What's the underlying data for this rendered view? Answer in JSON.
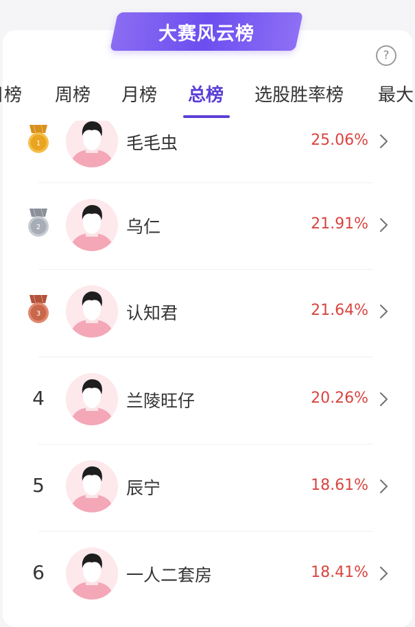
{
  "banner": {
    "title": "大赛风云榜"
  },
  "help": {
    "icon": "question-circle-icon",
    "label": "?"
  },
  "tabs": [
    {
      "label": "日榜"
    },
    {
      "label": "周榜"
    },
    {
      "label": "月榜"
    },
    {
      "label": "总榜",
      "active": true
    },
    {
      "label": "选股胜率榜"
    },
    {
      "label": "最大"
    }
  ],
  "leaderboard": [
    {
      "rank": "1",
      "badge": "gold-medal-icon",
      "name": "毛毛虫",
      "rate": "25.06%"
    },
    {
      "rank": "2",
      "badge": "silver-medal-icon",
      "name": "乌仁",
      "rate": "21.91%"
    },
    {
      "rank": "3",
      "badge": "bronze-medal-icon",
      "name": "认知君",
      "rate": "21.64%"
    },
    {
      "rank": "4",
      "name": "兰陵旺仔",
      "rate": "20.26%"
    },
    {
      "rank": "5",
      "name": "辰宁",
      "rate": "18.61%"
    },
    {
      "rank": "6",
      "name": "一人二套房",
      "rate": "18.41%"
    }
  ],
  "colors": {
    "accent": "#5b3fd6",
    "rate": "#d9443f",
    "gold": "#e9a421",
    "silver": "#a6adb6",
    "bronze": "#c9674a"
  }
}
